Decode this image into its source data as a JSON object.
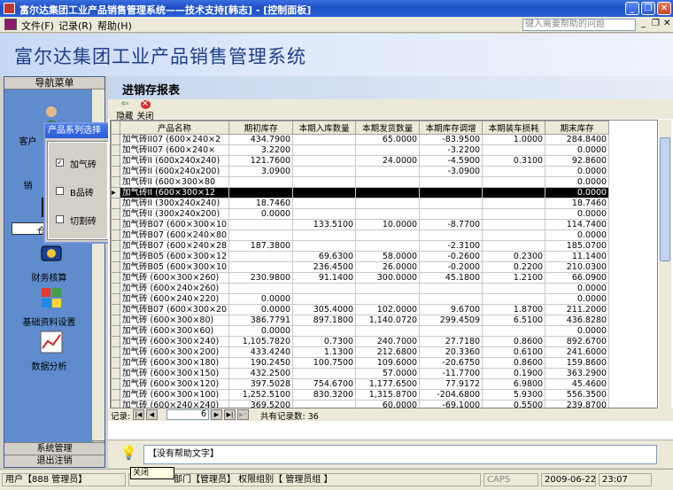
{
  "window": {
    "title": "富尔达集团工业产品销售管理系统——技术支持[韩志] - [控制面板]"
  },
  "menu": {
    "items": [
      "文件(F)",
      "记录(R)",
      "帮助(H)"
    ],
    "help_placeholder": "键入需要帮助的问题"
  },
  "banner": {
    "title": "富尔达集团工业产品销售管理系统"
  },
  "nav": {
    "header": "导航菜单",
    "items": [
      "客户",
      "销",
      "仓",
      "财务核算",
      "基础资料设置",
      "数据分析"
    ],
    "bottom1": "系统管理",
    "bottom2": "退出注销"
  },
  "popup": {
    "title": "产品系列选择",
    "options": [
      {
        "label": "加气砖",
        "checked": true
      },
      {
        "label": "B品砖",
        "checked": false
      },
      {
        "label": "切割砖",
        "checked": false
      }
    ]
  },
  "main": {
    "title": "进销存报表",
    "toolbar": {
      "hide": "隐藏",
      "close": "关闭"
    }
  },
  "grid": {
    "headers": [
      "产品名称",
      "期初库存",
      "本期入库数量",
      "本期发货数量",
      "本期库存调增",
      "本期装车损耗",
      "期末库存"
    ],
    "rows": [
      [
        "加气砖II07 (600×240×2",
        "434.7900",
        "",
        "65.0000",
        "-83.9500",
        "1.0000",
        "284.8400"
      ],
      [
        "加气砖II07 (600×240×",
        "3.2200",
        "",
        "",
        "-3.2200",
        "",
        "0.0000"
      ],
      [
        "加气砖II (600x240x240)",
        "121.7600",
        "",
        "24.0000",
        "-4.5900",
        "0.3100",
        "92.8600"
      ],
      [
        "加气砖II (600x240x200)",
        "3.0900",
        "",
        "",
        "-3.0900",
        "",
        "0.0000"
      ],
      [
        "加气砖II (600×300×80",
        "",
        "",
        "",
        "",
        "",
        "0.0000"
      ],
      [
        "加气砖II (600×300×12",
        "",
        "",
        "",
        "",
        "",
        "0.0000"
      ],
      [
        "加气砖II (300x240x240)",
        "18.7460",
        "",
        "",
        "",
        "",
        "18.7460"
      ],
      [
        "加气砖II (300x240x200)",
        "0.0000",
        "",
        "",
        "",
        "",
        "0.0000"
      ],
      [
        "加气砖B07 (600×300×10",
        "",
        "133.5100",
        "10.0000",
        "-8.7700",
        "",
        "114.7400"
      ],
      [
        "加气砖B07 (600×240×80",
        "",
        "",
        "",
        "",
        "",
        "0.0000"
      ],
      [
        "加气砖B07 (600×240×28",
        "187.3800",
        "",
        "",
        "-2.3100",
        "",
        "185.0700"
      ],
      [
        "加气砖B05 (600×300×12",
        "",
        "69.6300",
        "58.0000",
        "-0.2600",
        "0.2300",
        "11.1400"
      ],
      [
        "加气砖B05 (600×300×10",
        "",
        "236.4500",
        "26.0000",
        "-0.2000",
        "0.2200",
        "210.0300"
      ],
      [
        "加气砖 (600×300×260)",
        "230.9800",
        "91.1400",
        "300.0000",
        "45.1800",
        "1.2100",
        "66.0900"
      ],
      [
        "加气砖 (600×240×260)",
        "",
        "",
        "",
        "",
        "",
        "0.0000"
      ],
      [
        "加气砖 (600×240×220)",
        "0.0000",
        "",
        "",
        "",
        "",
        "0.0000"
      ],
      [
        "加气砖B07 (600×300×20",
        "0.0000",
        "305.4000",
        "102.0000",
        "9.6700",
        "1.8700",
        "211.2000"
      ],
      [
        "加气砖 (600×300×80)",
        "386.7791",
        "897.1800",
        "1,140.0720",
        "299.4509",
        "6.5100",
        "436.8280"
      ],
      [
        "加气砖 (600×300×60)",
        "0.0000",
        "",
        "",
        "",
        "",
        "0.0000"
      ],
      [
        "加气砖 (600×300×240)",
        "1,105.7820",
        "0.7300",
        "240.7000",
        "27.7180",
        "0.8600",
        "892.6700"
      ],
      [
        "加气砖 (600×300×200)",
        "433.4240",
        "1.1300",
        "212.6800",
        "20.3360",
        "0.6100",
        "241.6000"
      ],
      [
        "加气砖 (600×300×180)",
        "190.2450",
        "100.7500",
        "109.6000",
        "-20.6750",
        "0.8600",
        "159.8600"
      ],
      [
        "加气砖 (600×300×150)",
        "432.2500",
        "",
        "57.0000",
        "-11.7700",
        "0.1900",
        "363.2900"
      ],
      [
        "加气砖 (600×300×120)",
        "397.5028",
        "754.6700",
        "1,177.6500",
        "77.9172",
        "6.9800",
        "45.4600"
      ],
      [
        "加气砖 (600×300×100)",
        "1,252.5100",
        "830.3200",
        "1,315.8700",
        "-204.6800",
        "5.9300",
        "556.3500"
      ],
      [
        "加气砖 (600×240×240)",
        "369.5200",
        "",
        "60.0000",
        "-69.1000",
        "0.5500",
        "239.8700"
      ]
    ]
  },
  "recnav": {
    "label": "记录:",
    "current": "6",
    "total_label": "共有记录数: 36"
  },
  "help": {
    "text": "【没有帮助文字】"
  },
  "tooltip": {
    "close": "关闭"
  },
  "status": {
    "user": "用户【888 管理员】",
    "role": "部门【管理员】 权限组别【 管理员组 】",
    "caps": "CAPS",
    "date": "2009-06-22",
    "time": "23:07"
  }
}
